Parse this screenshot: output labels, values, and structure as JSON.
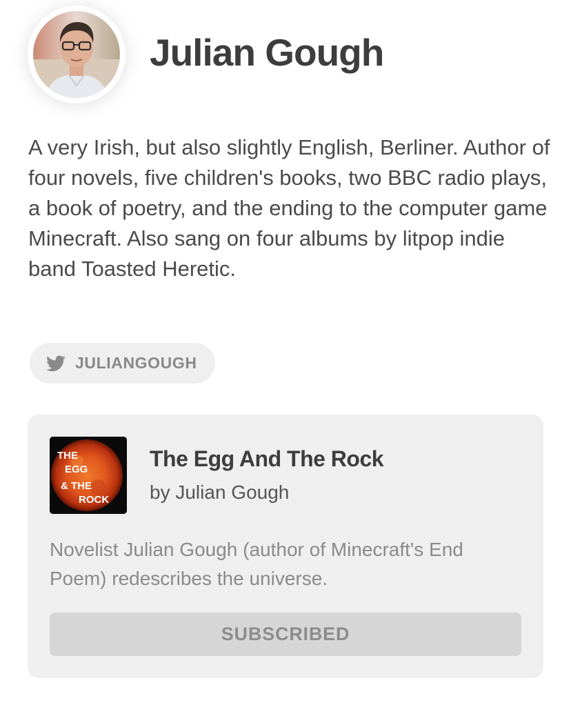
{
  "author": {
    "name": "Julian Gough",
    "avatar_icon": "author-portrait",
    "bio": "A very Irish, but also slightly English, Berliner. Author of four novels, five children's books, two BBC radio plays, a book of poetry, and the ending to the computer game Minecraft. Also sang on four albums by litpop indie band Toasted Heretic."
  },
  "social": {
    "icon": "twitter-icon",
    "handle": "JULIANGOUGH"
  },
  "publication": {
    "title": "The Egg And The Rock",
    "byline": "by Julian Gough",
    "description": "Novelist Julian Gough (author of Minecraft's End Poem) redescribes the universe.",
    "cover": {
      "line1": "THE",
      "line2": "EGG",
      "line3": "& THE",
      "line4": "ROCK"
    },
    "subscribe_label": "SUBSCRIBED"
  },
  "colors": {
    "text": "#444444",
    "card_bg": "#efefef",
    "button_bg": "#d6d6d6",
    "muted": "#8a8a8a",
    "sun_orange": "#e0561d"
  }
}
